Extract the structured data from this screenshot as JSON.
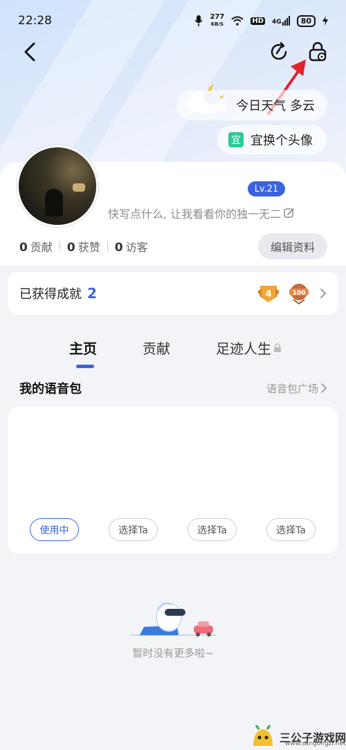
{
  "status_bar": {
    "time": "22:28",
    "net_speed_value": "277",
    "net_speed_unit": "KB/S",
    "hd": "HD",
    "signal": "4G",
    "battery": "80"
  },
  "nav": {
    "back_icon": "chevron-left-icon",
    "refresh_icon": "refresh-icon",
    "settings_icon": "lock-gear-icon"
  },
  "weather": {
    "label": "今日天气 多云",
    "icon": "cloud-moon-icon"
  },
  "avatar_action": {
    "badge": "宜",
    "label": "宜换个头像"
  },
  "profile": {
    "level": "Lv.21",
    "signature": "快写点什么, 让我看看你的独一无二",
    "stats": [
      {
        "count": "0",
        "label": "贡献"
      },
      {
        "count": "0",
        "label": "获赞"
      },
      {
        "count": "0",
        "label": "访客"
      }
    ],
    "edit_label": "编辑资料"
  },
  "achievement": {
    "label": "已获得成就",
    "count": "2",
    "medals": [
      "medal-4-icon",
      "medal-100-icon"
    ]
  },
  "tabs": [
    {
      "label": "主页",
      "active": true
    },
    {
      "label": "贡献",
      "active": false
    },
    {
      "label": "足迹人生",
      "active": false,
      "locked": true
    }
  ],
  "voice_section": {
    "title": "我的语音包",
    "link": "语音包广场",
    "buttons": [
      "使用中",
      "选择Ta",
      "选择Ta",
      "选择Ta"
    ]
  },
  "empty_state": {
    "text": "暂时没有更多啦~"
  },
  "watermark": {
    "text": "三公子游戏网",
    "url": "www.sangongzi.net"
  },
  "colors": {
    "accent": "#3b63e0",
    "annotation_arrow": "#e0242a",
    "badge_green": "#2fc79b"
  }
}
